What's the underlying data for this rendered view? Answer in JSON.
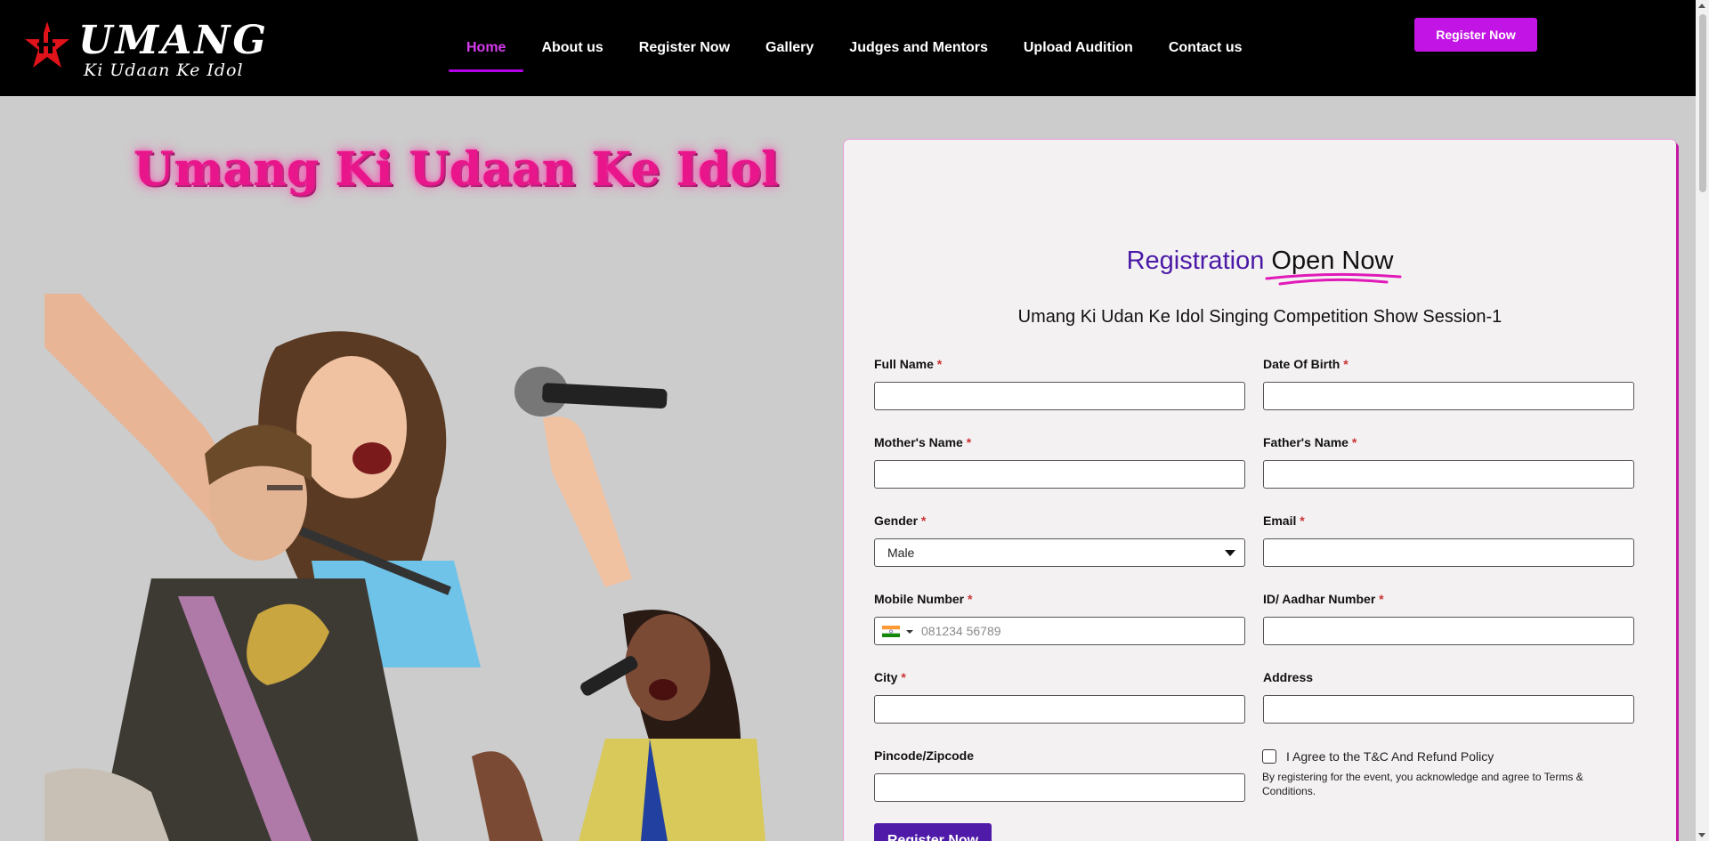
{
  "header": {
    "logo_text": "UMANG",
    "logo_subtext": "Ki Udaan Ke Idol",
    "nav": [
      {
        "label": "Home",
        "active": true
      },
      {
        "label": "About us"
      },
      {
        "label": "Register Now"
      },
      {
        "label": "Gallery"
      },
      {
        "label": "Judges and Mentors"
      },
      {
        "label": "Upload Audition"
      },
      {
        "label": "Contact us"
      }
    ],
    "cta_label": "Register Now"
  },
  "hero": {
    "title": "Umang Ki Udaan Ke Idol"
  },
  "form": {
    "heading_part1": "Registration",
    "heading_part2": "Open Now",
    "session_title": "Umang Ki Udan Ke Idol Singing Competition Show Session-1",
    "fields": {
      "full_name": {
        "label": "Full Name",
        "value": ""
      },
      "dob": {
        "label": "Date Of Birth",
        "value": ""
      },
      "mother_name": {
        "label": "Mother's Name",
        "value": ""
      },
      "father_name": {
        "label": "Father's Name",
        "value": ""
      },
      "gender": {
        "label": "Gender",
        "value": "Male"
      },
      "email": {
        "label": "Email",
        "value": ""
      },
      "mobile": {
        "label": "Mobile Number",
        "placeholder": "081234 56789"
      },
      "aadhar": {
        "label": "ID/ Aadhar Number",
        "value": ""
      },
      "city": {
        "label": "City",
        "value": ""
      },
      "address": {
        "label": "Address",
        "value": ""
      },
      "pincode": {
        "label": "Pincode/Zipcode",
        "value": ""
      }
    },
    "agree_label": "I Agree to the T&C And Refund Policy",
    "agree_note": "By registering for the event, you acknowledge and agree to Terms & Conditions.",
    "required_mark": "*",
    "submit_label": "Register Now"
  },
  "colors": {
    "accent_purple": "#4b1aa6",
    "accent_magenta": "#c314e6",
    "hero_pink": "#e8168a"
  }
}
